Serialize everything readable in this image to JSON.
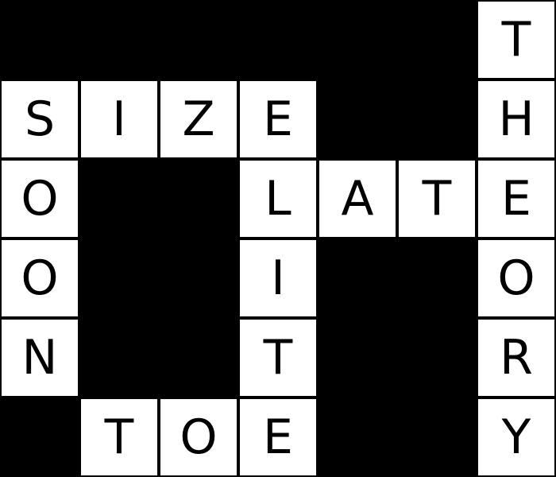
{
  "board": {
    "rows": 6,
    "cols": 7,
    "colors": {
      "block": "#000000",
      "cell": "#ffffff",
      "text": "#000000"
    },
    "cells": [
      {
        "row": 0,
        "col": 6,
        "letter": "T"
      },
      {
        "row": 1,
        "col": 0,
        "letter": "S"
      },
      {
        "row": 1,
        "col": 1,
        "letter": "I"
      },
      {
        "row": 1,
        "col": 2,
        "letter": "Z"
      },
      {
        "row": 1,
        "col": 3,
        "letter": "E"
      },
      {
        "row": 1,
        "col": 6,
        "letter": "H"
      },
      {
        "row": 2,
        "col": 0,
        "letter": "O"
      },
      {
        "row": 2,
        "col": 3,
        "letter": "L"
      },
      {
        "row": 2,
        "col": 4,
        "letter": "A"
      },
      {
        "row": 2,
        "col": 5,
        "letter": "T"
      },
      {
        "row": 2,
        "col": 6,
        "letter": "E"
      },
      {
        "row": 3,
        "col": 0,
        "letter": "O"
      },
      {
        "row": 3,
        "col": 3,
        "letter": "I"
      },
      {
        "row": 3,
        "col": 6,
        "letter": "O"
      },
      {
        "row": 4,
        "col": 0,
        "letter": "N"
      },
      {
        "row": 4,
        "col": 3,
        "letter": "T"
      },
      {
        "row": 4,
        "col": 6,
        "letter": "R"
      },
      {
        "row": 5,
        "col": 1,
        "letter": "T"
      },
      {
        "row": 5,
        "col": 2,
        "letter": "O"
      },
      {
        "row": 5,
        "col": 3,
        "letter": "E"
      },
      {
        "row": 5,
        "col": 6,
        "letter": "Y"
      }
    ]
  }
}
